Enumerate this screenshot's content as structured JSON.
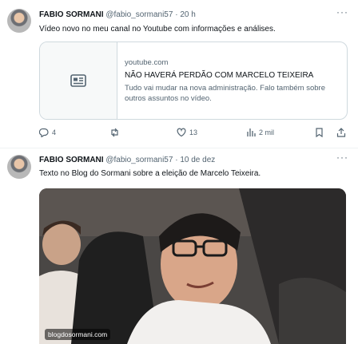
{
  "tweets": [
    {
      "author_name": "FABIO SORMANI",
      "handle": "@fabio_sormani57",
      "separator": "·",
      "time": "20 h",
      "text": "Vídeo novo no meu canal no Youtube com informações e análises.",
      "card": {
        "domain": "youtube.com",
        "title": "NÃO HAVERÁ PERDÃO COM MARCELO TEIXEIRA",
        "description": "Tudo vai mudar na nova administração. Falo também sobre outros assuntos no vídeo."
      },
      "actions": {
        "replies": "4",
        "reposts": "",
        "likes": "13",
        "views": "2 mil"
      }
    },
    {
      "author_name": "FABIO SORMANI",
      "handle": "@fabio_sormani57",
      "separator": "·",
      "time": "10 de dez",
      "text": "Texto no Blog do Sormani sobre a eleição de Marcelo Teixeira.",
      "image": {
        "watermark": "blogdosormani.com"
      }
    }
  ],
  "icons": [
    "more-icon",
    "link-card-icon",
    "reply-icon",
    "repost-icon",
    "like-icon",
    "views-icon",
    "bookmark-icon",
    "share-icon"
  ],
  "colors": {
    "text": "#0f1419",
    "muted": "#536471",
    "border": "#cfd9de"
  }
}
